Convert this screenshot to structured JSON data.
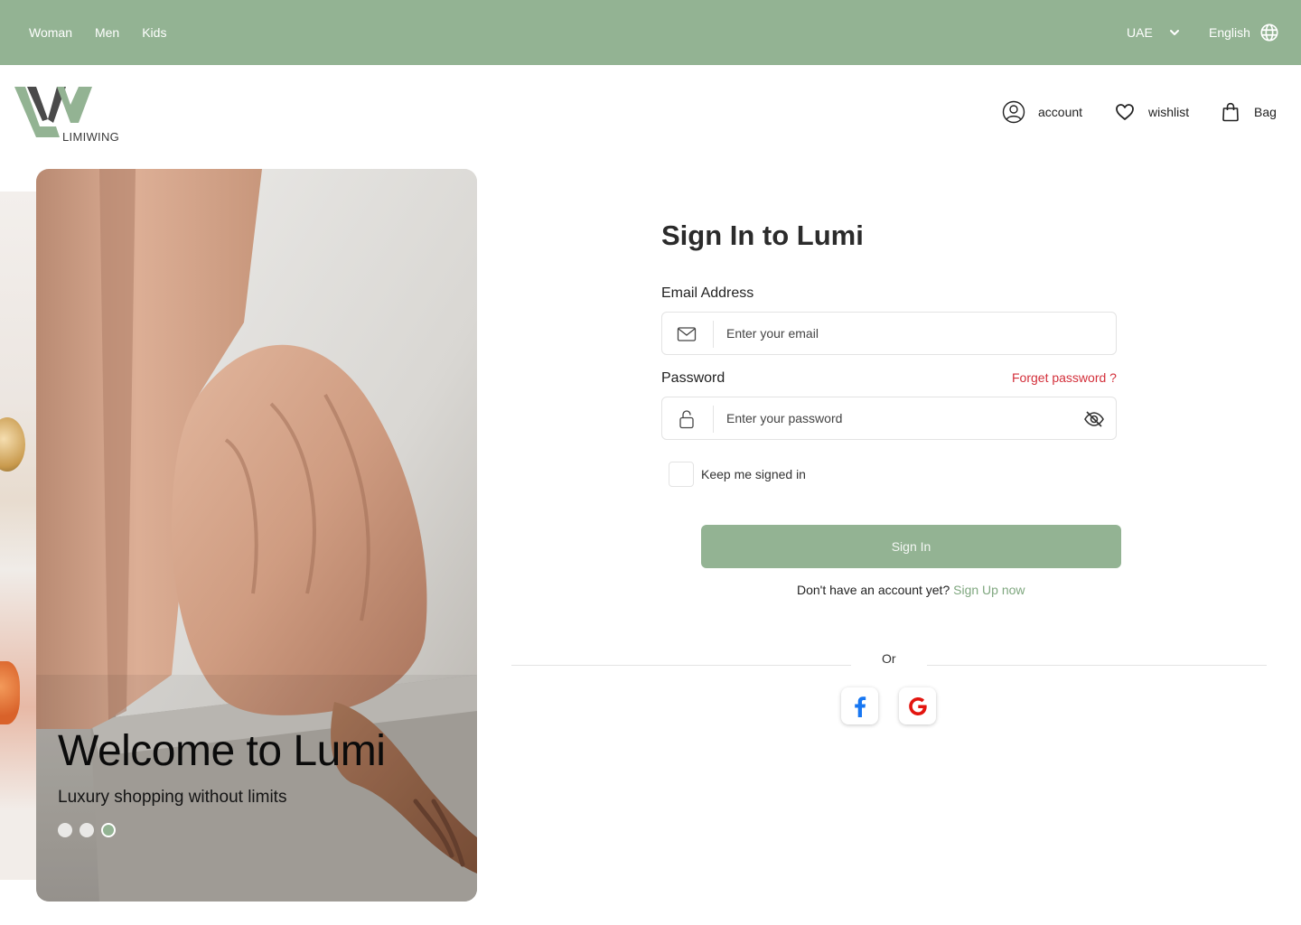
{
  "top_nav": {
    "links": [
      "Woman",
      "Men",
      "Kids"
    ],
    "region": "UAE",
    "language": "English"
  },
  "brand": {
    "name": "LIMIWING",
    "color": "#93b393"
  },
  "header": {
    "account_label": "account",
    "wishlist_label": "wishlist",
    "bag_label": "Bag"
  },
  "hero": {
    "title": "Welcome to Lumi",
    "subtitle": "Luxury shopping without limits",
    "slide_count": 3,
    "active_slide": 3
  },
  "form": {
    "title": "Sign In to Lumi",
    "email_label": "Email Address",
    "email_placeholder": "Enter your email",
    "password_label": "Password",
    "password_placeholder": "Enter your password",
    "forgot_label": "Forget password ?",
    "keep_signed_in_label": "Keep me signed in",
    "submit_label": "Sign In",
    "signup_prompt": "Don't have an account yet?",
    "signup_link": "Sign Up now",
    "or_label": "Or"
  },
  "social": [
    "facebook",
    "google"
  ],
  "colors": {
    "accent": "#93b393",
    "danger": "#d32f3a",
    "facebook": "#1877f2",
    "google": "#e3150f"
  }
}
